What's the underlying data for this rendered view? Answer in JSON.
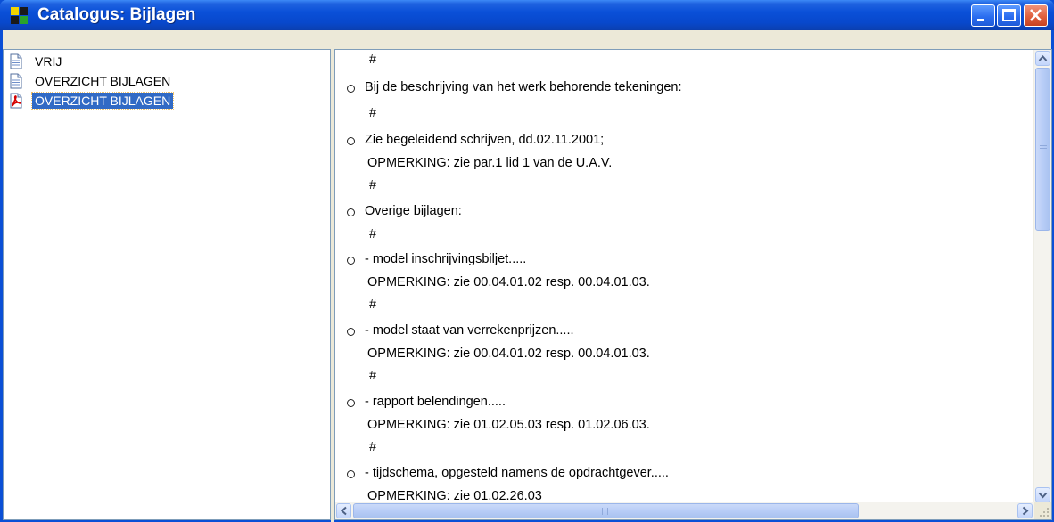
{
  "window": {
    "title": "Catalogus: Bijlagen",
    "title_color": "#ffffff",
    "titlebar_color": "#0a50d8"
  },
  "titlebar_buttons": [
    "minimize-icon",
    "maximize-icon",
    "close-icon"
  ],
  "tree": {
    "items": [
      {
        "label": "VRIJ",
        "icon": "document-icon",
        "selected": false
      },
      {
        "label": "OVERZICHT BIJLAGEN",
        "icon": "document-icon",
        "selected": false
      },
      {
        "label": "OVERZICHT BIJLAGEN",
        "icon": "pdf-document-icon",
        "selected": true
      }
    ],
    "selection_color": "#316ac5"
  },
  "content": {
    "lines": [
      {
        "bullet": false,
        "text": "#"
      },
      {
        "bullet": true,
        "text": "Bij de beschrijving van het werk behorende tekeningen:"
      },
      {
        "bullet": false,
        "text": "#"
      },
      {
        "bullet": true,
        "text": "Zie begeleidend schrijven, dd.02.11.2001;"
      },
      {
        "bullet": false,
        "text": "OPMERKING: zie par.1 lid 1 van de U.A.V."
      },
      {
        "bullet": false,
        "text": "#"
      },
      {
        "bullet": true,
        "text": "Overige bijlagen:"
      },
      {
        "bullet": false,
        "text": "#"
      },
      {
        "bullet": true,
        "text": "- model inschrijvingsbiljet....."
      },
      {
        "bullet": false,
        "text": "OPMERKING: zie 00.04.01.02 resp. 00.04.01.03."
      },
      {
        "bullet": false,
        "text": "#"
      },
      {
        "bullet": true,
        "text": "- model staat van verrekenprijzen....."
      },
      {
        "bullet": false,
        "text": "OPMERKING: zie 00.04.01.02 resp. 00.04.01.03."
      },
      {
        "bullet": false,
        "text": "#"
      },
      {
        "bullet": true,
        "text": "- rapport belendingen....."
      },
      {
        "bullet": false,
        "text": "OPMERKING: zie 01.02.05.03 resp. 01.02.06.03."
      },
      {
        "bullet": false,
        "text": "#"
      },
      {
        "bullet": true,
        "text": "- tijdschema, opgesteld namens de opdrachtgever....."
      },
      {
        "bullet": false,
        "text": "OPMERKING: zie 01.02.26.03"
      }
    ]
  },
  "scrollbars": {
    "vertical": {
      "up": "scroll-up-icon",
      "down": "scroll-down-icon"
    },
    "horizontal": {
      "left": "scroll-left-icon",
      "right": "scroll-right-icon"
    }
  }
}
